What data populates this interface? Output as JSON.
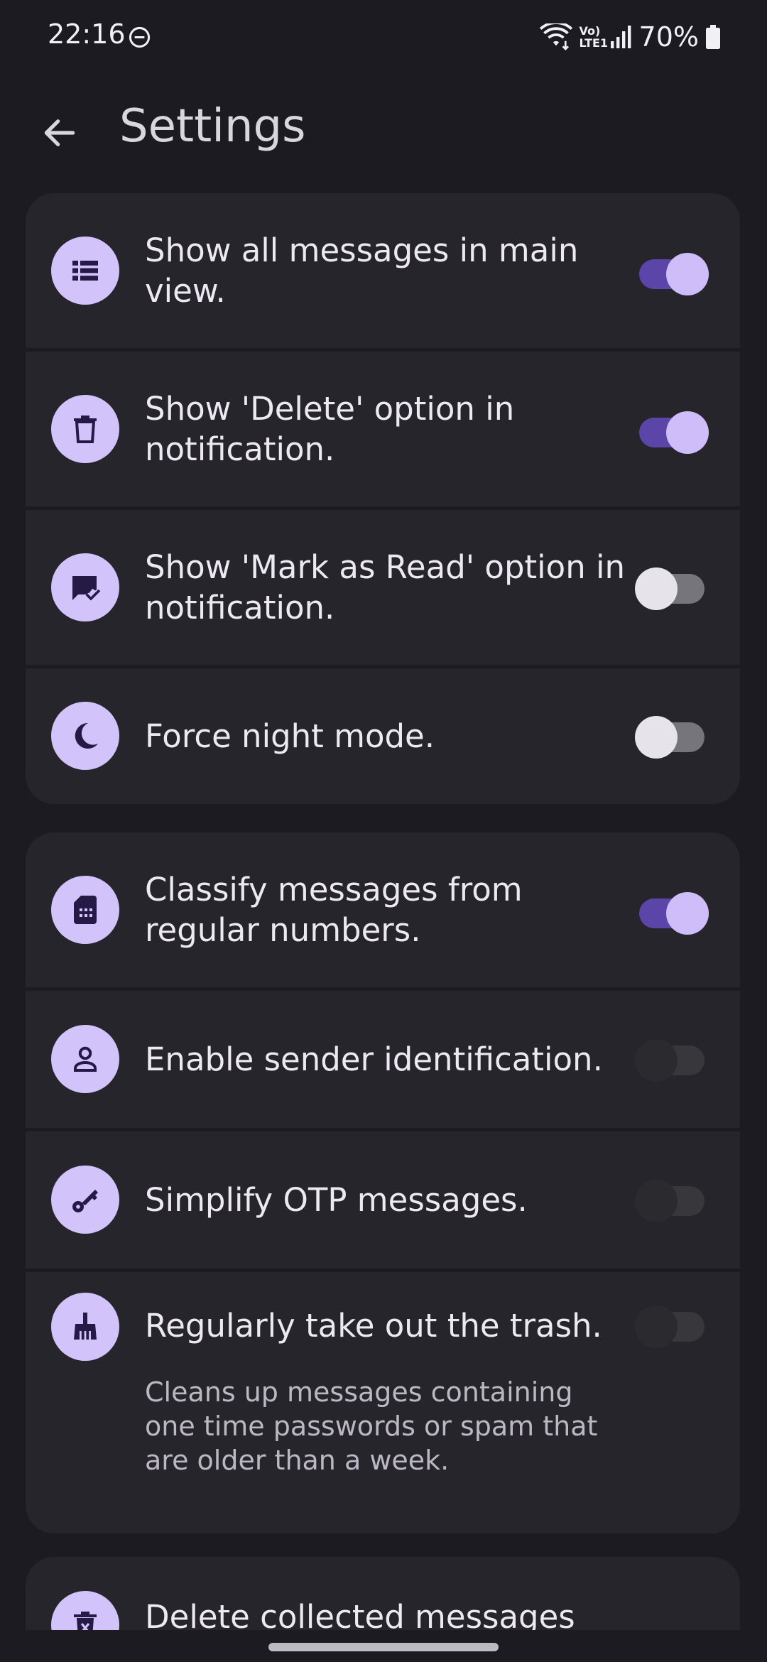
{
  "status_bar": {
    "time": "22:16",
    "network_label": "Vo) LTE1",
    "battery_percent": "70%",
    "icons": [
      "dnd-icon",
      "wifi-icon",
      "volte-icon",
      "signal-icon",
      "battery-icon"
    ]
  },
  "header": {
    "title": "Settings",
    "back_icon": "arrow-back-icon"
  },
  "groups": [
    {
      "items": [
        {
          "label": "Show all messages in main view.",
          "icon": "list-view-icon",
          "enabled": true
        },
        {
          "label": "Show 'Delete' option in notification.",
          "icon": "trash-icon",
          "enabled": true
        },
        {
          "label": "Show 'Mark as Read' option in notification.",
          "icon": "mark-read-icon",
          "enabled": false
        },
        {
          "label": "Force night mode.",
          "icon": "moon-icon",
          "enabled": false
        }
      ]
    },
    {
      "items": [
        {
          "label": "Classify messages from regular numbers.",
          "icon": "sim-card-icon",
          "enabled": true
        },
        {
          "label": "Enable sender identification.",
          "icon": "person-icon",
          "enabled": false
        },
        {
          "label": "Simplify OTP messages.",
          "icon": "key-icon",
          "enabled": false
        },
        {
          "label": "Regularly take out the trash.",
          "icon": "broom-icon",
          "enabled": false,
          "description": "Cleans up messages containing one time passwords or spam that are older than a week."
        }
      ]
    },
    {
      "items": [
        {
          "label": "Delete collected messages data",
          "icon": "delete-forever-icon"
        }
      ]
    }
  ],
  "colors": {
    "background": "#1c1b21",
    "card": "#26252b",
    "accent": "#d2c3fb",
    "switch_on_track": "#5b45a8"
  }
}
